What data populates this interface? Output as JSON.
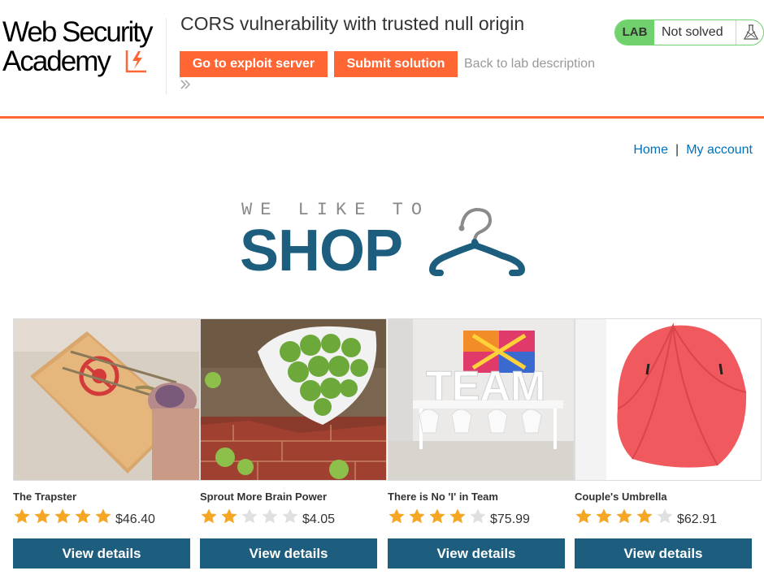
{
  "header": {
    "logo_line1": "Web Security",
    "logo_line2": "Academy",
    "lab_title": "CORS vulnerability with trusted null origin",
    "exploit_button": "Go to exploit server",
    "submit_button": "Submit solution",
    "back_link": "Back to lab description",
    "lab_badge": "LAB",
    "lab_state": "Not solved",
    "accent_color": "#ff6633",
    "solved_badge_color": "#70d16d"
  },
  "nav": {
    "home": "Home",
    "separator": "|",
    "my_account": "My account",
    "link_color": "#0071bc"
  },
  "banner": {
    "small_text": "WE LIKE TO",
    "big_text": "SHOP",
    "color": "#1d5e7f"
  },
  "products": [
    {
      "name": "The Trapster",
      "rating": 5,
      "price": "$46.40",
      "button": "View details",
      "image": "mousetrap-photo"
    },
    {
      "name": "Sprout More Brain Power",
      "rating": 2,
      "price": "$4.05",
      "button": "View details",
      "image": "brussels-sprouts-photo"
    },
    {
      "name": "There is No 'I' in Team",
      "rating": 4,
      "price": "$75.99",
      "button": "View details",
      "image": "team-letters-photo"
    },
    {
      "name": "Couple's Umbrella",
      "rating": 4,
      "price": "$62.91",
      "button": "View details",
      "image": "red-umbrella-photo"
    }
  ]
}
